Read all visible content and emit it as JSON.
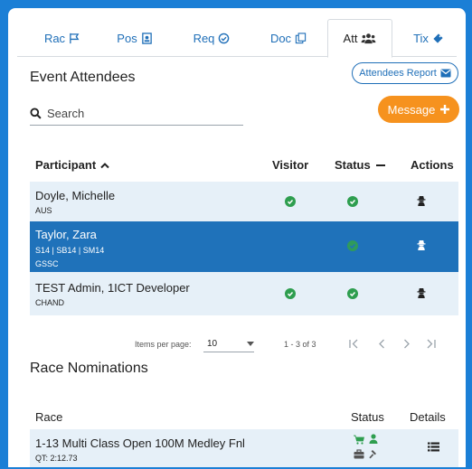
{
  "tabs": [
    {
      "label": "Rac",
      "icon": "flag-icon"
    },
    {
      "label": "Pos",
      "icon": "id-badge-icon"
    },
    {
      "label": "Req",
      "icon": "check-circle-icon"
    },
    {
      "label": "Doc",
      "icon": "copy-icon"
    },
    {
      "label": "Att",
      "icon": "users-icon"
    },
    {
      "label": "Tix",
      "icon": "ticket-icon"
    }
  ],
  "attendees": {
    "title": "Event Attendees",
    "report_label": "Attendees Report",
    "search_placeholder": "Search",
    "message_label": "Message",
    "columns": {
      "participant": "Participant",
      "visitor": "Visitor",
      "status": "Status",
      "actions": "Actions"
    },
    "rows": [
      {
        "name": "Doyle, Michelle",
        "line1": "AUS",
        "line2": "",
        "visitor": true,
        "status": true,
        "selected": false
      },
      {
        "name": "Taylor, Zara",
        "line1": "S14 | SB14 | SM14",
        "line2": "GSSC",
        "visitor": false,
        "status": true,
        "selected": true
      },
      {
        "name": "TEST Admin, 1ICT Developer",
        "line1": "CHAND",
        "line2": "",
        "visitor": true,
        "status": true,
        "selected": false
      }
    ],
    "pager": {
      "items_per_page_label": "Items per page:",
      "items_per_page": "10",
      "range": "1 - 3 of 3"
    }
  },
  "nominations": {
    "title": "Race Nominations",
    "columns": {
      "race": "Race",
      "status": "Status",
      "details": "Details"
    },
    "rows": [
      {
        "race": "1-13 Multi Class Open 100M Medley Fnl",
        "qt": "QT: 2:12.73"
      }
    ]
  },
  "colors": {
    "primary": "#1f6fb8",
    "accent": "#f6921e",
    "selected_row": "#1f72ba",
    "row_bg": "#e6f0f8",
    "success": "#2e9e4f"
  }
}
